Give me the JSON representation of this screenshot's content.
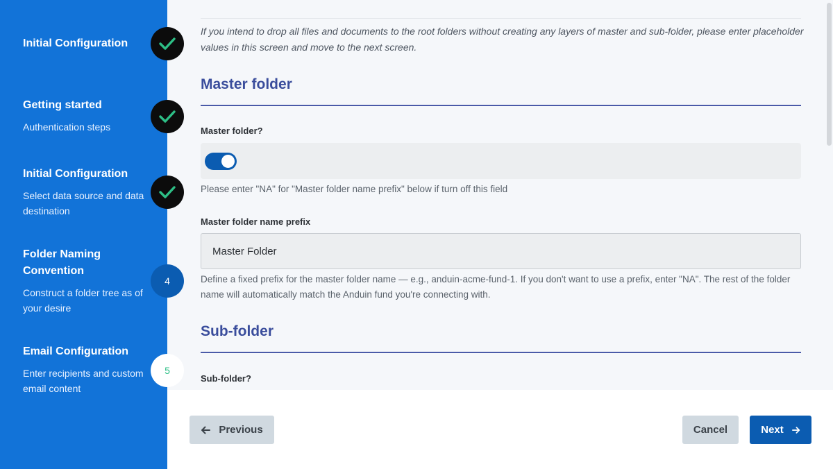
{
  "sidebar": {
    "steps": [
      {
        "title": "Initial Configuration",
        "subtitle": "",
        "state": "done"
      },
      {
        "title": "Getting started",
        "subtitle": "Authentication steps",
        "state": "done"
      },
      {
        "title": "Initial Configuration",
        "subtitle": "Select data source and data destination",
        "state": "done"
      },
      {
        "title": "Folder Naming Convention",
        "subtitle": "Construct a folder tree as of your desire",
        "state": "current",
        "number": "4"
      },
      {
        "title": "Email Configuration",
        "subtitle": "Enter recipients and custom email content",
        "state": "todo",
        "number": "5"
      }
    ]
  },
  "main": {
    "intro": "If you intend to drop all files and documents to the root folders without creating any layers of master and sub-folder, please enter placeholder values in this screen and move to the next screen.",
    "master_section": {
      "title": "Master folder",
      "toggle_label": "Master folder?",
      "toggle_on": true,
      "toggle_help": "Please enter \"NA\" for \"Master folder name prefix\" below if turn off this field",
      "prefix_label": "Master folder name prefix",
      "prefix_value": "Master Folder",
      "prefix_help": "Define a fixed prefix for the master folder name — e.g., anduin-acme-fund-1. If you don't want to use a prefix, enter \"NA\". The rest of the folder name will automatically match the Anduin fund you're connecting with."
    },
    "sub_section": {
      "title": "Sub-folder",
      "toggle_label": "Sub-folder?"
    }
  },
  "footer": {
    "previous_label": "Previous",
    "cancel_label": "Cancel",
    "next_label": "Next"
  },
  "colors": {
    "sidebar_bg": "#1273d8",
    "accent": "#0b5cb1",
    "check": "#2dbf86",
    "section_title": "#3a4d9c"
  },
  "icons": {
    "done_badge": "check-icon",
    "previous": "arrow-left-icon",
    "next": "arrow-right-icon"
  }
}
